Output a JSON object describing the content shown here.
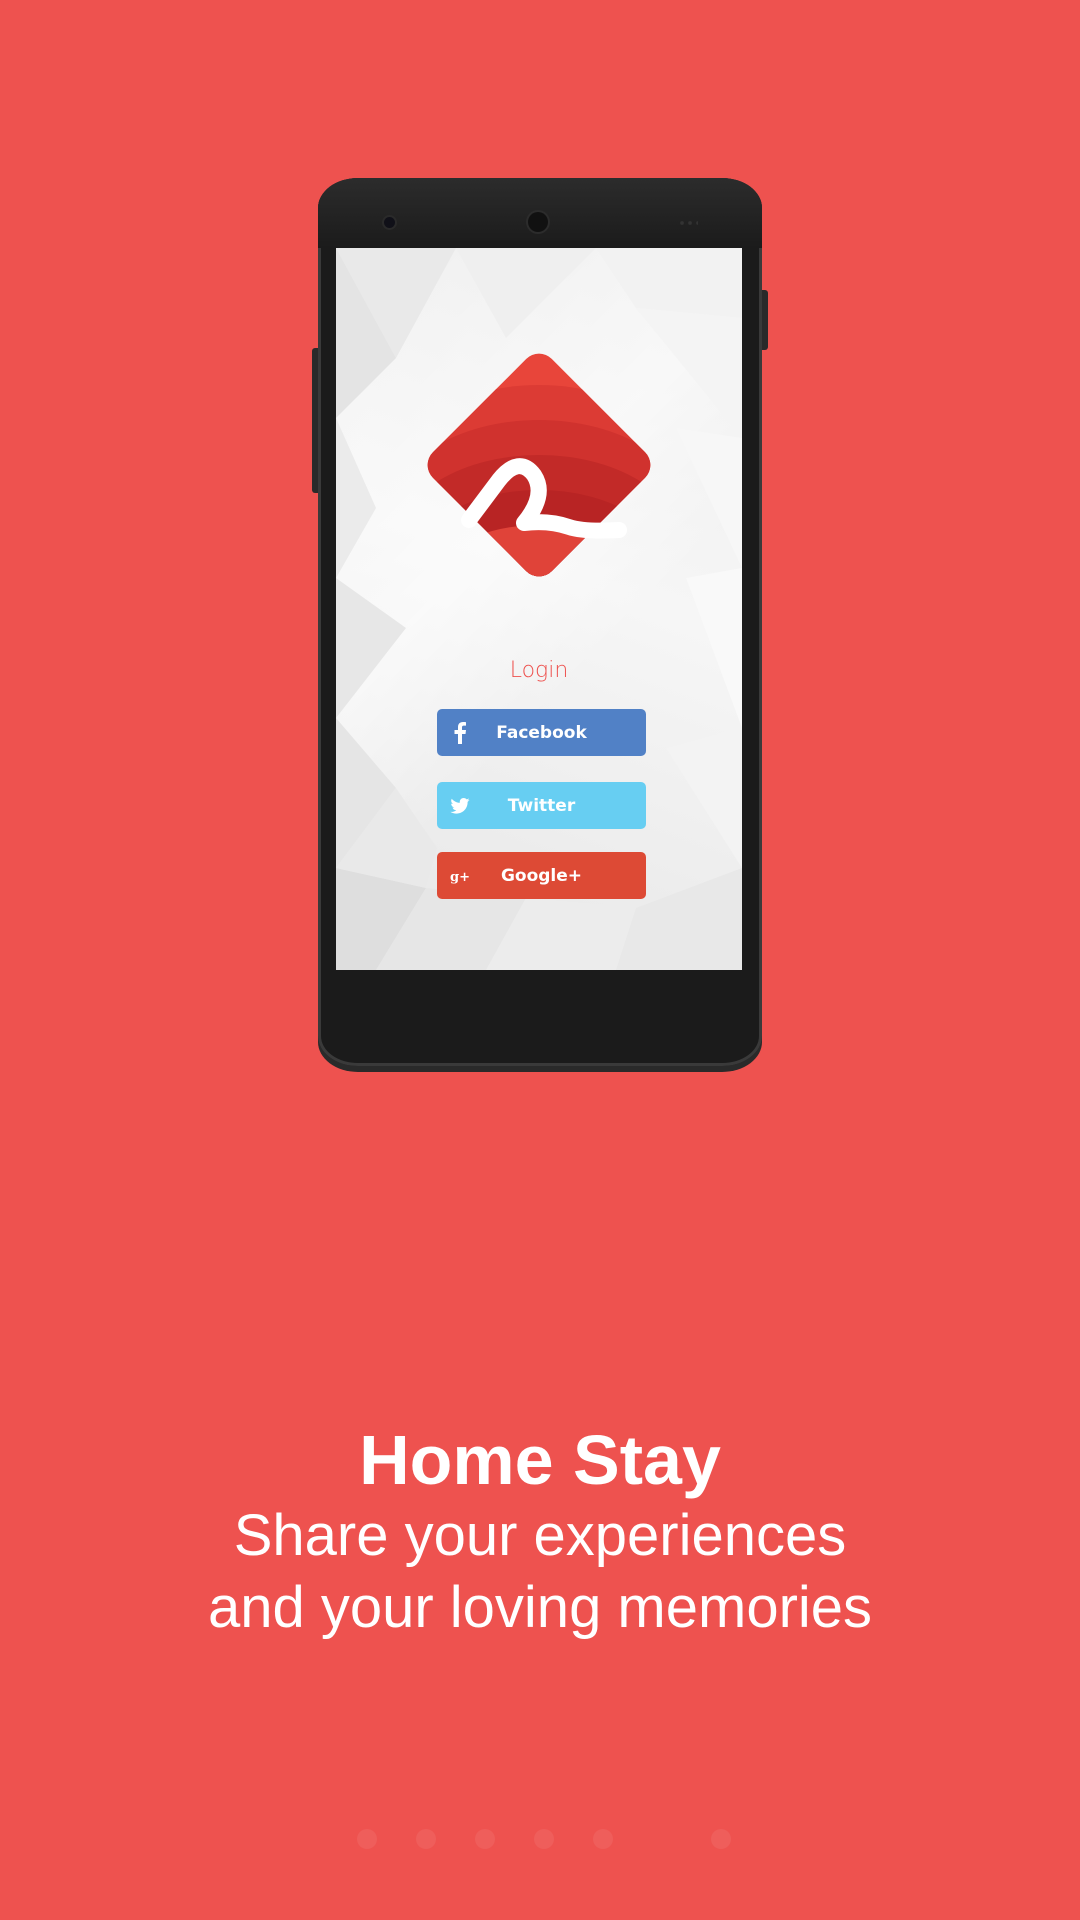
{
  "screen": {
    "login_label": "Login",
    "buttons": [
      {
        "label": "Facebook",
        "icon": "facebook-icon",
        "color": "#5181C6"
      },
      {
        "label": "Twitter",
        "icon": "twitter-icon",
        "color": "#67CEF2"
      },
      {
        "label": "Google+",
        "icon": "google-plus-icon",
        "color": "#DD4A35"
      }
    ]
  },
  "promo": {
    "title": "Home Stay",
    "tagline_line1": "Share your experiences",
    "tagline_line2": "and your loving memories"
  },
  "pager": {
    "total": 7,
    "active_index": 5
  },
  "colors": {
    "background": "#EE524F",
    "accent": "#EE524F"
  }
}
